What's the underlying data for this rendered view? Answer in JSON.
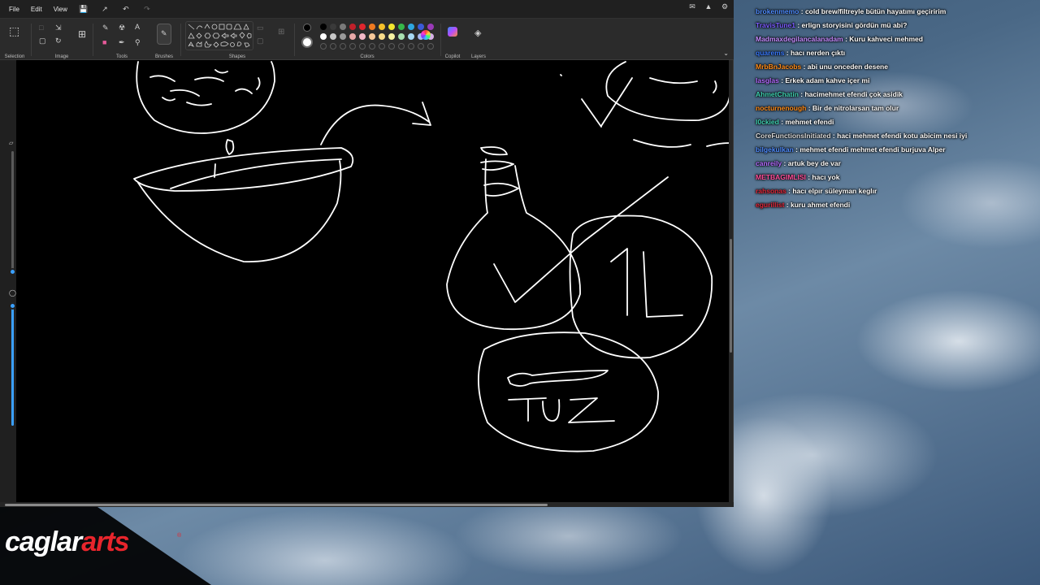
{
  "app": {
    "menu": [
      "File",
      "Edit",
      "View"
    ]
  },
  "ribbon": {
    "groups": {
      "selection": "Selection",
      "image": "Image",
      "tools": "Tools",
      "brushes": "Brushes",
      "shapes": "Shapes",
      "colors": "Colors",
      "copilot": "Copilot",
      "layers": "Layers"
    },
    "palette_row1": [
      "#000000",
      "#3a3a3a",
      "#7a7a7a",
      "#c0202a",
      "#e0262e",
      "#f07a20",
      "#f6c12a",
      "#f2e62e",
      "#36b84a",
      "#2ea6e0",
      "#3b5ad8",
      "#9b3ab8"
    ],
    "palette_row2": [
      "#ffffff",
      "#c8c8c8",
      "#9a9a9a",
      "#e8a8a8",
      "#f4b8c8",
      "#f6c89a",
      "#f8dc8a",
      "#f6f2a2",
      "#a8e0b0",
      "#a8d8f2",
      "#a8b8f0",
      "#d6b0e6"
    ]
  },
  "chat": {
    "messages": [
      {
        "user": "brokenmemo",
        "color": "#4f8cff",
        "text": "cold brew/filtreyle bütün hayatımı geçiririm"
      },
      {
        "user": "TravisTune1",
        "color": "#7b5cff",
        "text": "erlign storyisini gördün mü abi?"
      },
      {
        "user": "Madmaxdegilancalanadam",
        "color": "#c58cff",
        "text": "Kuru kahveci mehmed"
      },
      {
        "user": "quarems",
        "color": "#3a7bff",
        "text": "hacı nerden çıktı"
      },
      {
        "user": "MrbBnJacobs",
        "color": "#ff8c1a",
        "text": "abi unu onceden desene"
      },
      {
        "user": "lasglas",
        "color": "#b36bff",
        "text": "Erkek adam kahve içer mi"
      },
      {
        "user": "AhmetChatin",
        "color": "#3fd0b0",
        "text": "hacimehmet efendi çok asidik"
      },
      {
        "user": "nocturnenough",
        "color": "#ff8c1a",
        "text": "Bir de nitrolarsan tam olur"
      },
      {
        "user": "l0ckied",
        "color": "#3fd0b0",
        "text": "mehmet efendi"
      },
      {
        "user": "CoreFunctionsInitiated",
        "color": "#d8d8d8",
        "text": "haci mehmet efendi kotu abicim nesi iyi"
      },
      {
        "user": "bilgekulkan",
        "color": "#4f8cff",
        "text": "mehmet efendi mehmet efendi burjuva Alper"
      },
      {
        "user": "canreily",
        "color": "#b36bff",
        "text": "artuk bey de var"
      },
      {
        "user": "METBAGIMLISI",
        "color": "#ff4f9a",
        "text": "hacı yok"
      },
      {
        "user": "rahsonas",
        "color": "#e0263a",
        "text": "hacı elpır süleyman keglır"
      },
      {
        "user": "egurillist",
        "color": "#e0263a",
        "text": "kuru ahmet efendi"
      }
    ]
  },
  "canvas_drawing": {
    "label_tuz": "TUZ",
    "label_1l": "1L"
  },
  "logo": {
    "part1": "caglar",
    "part2": "arts",
    "reg": "®"
  }
}
